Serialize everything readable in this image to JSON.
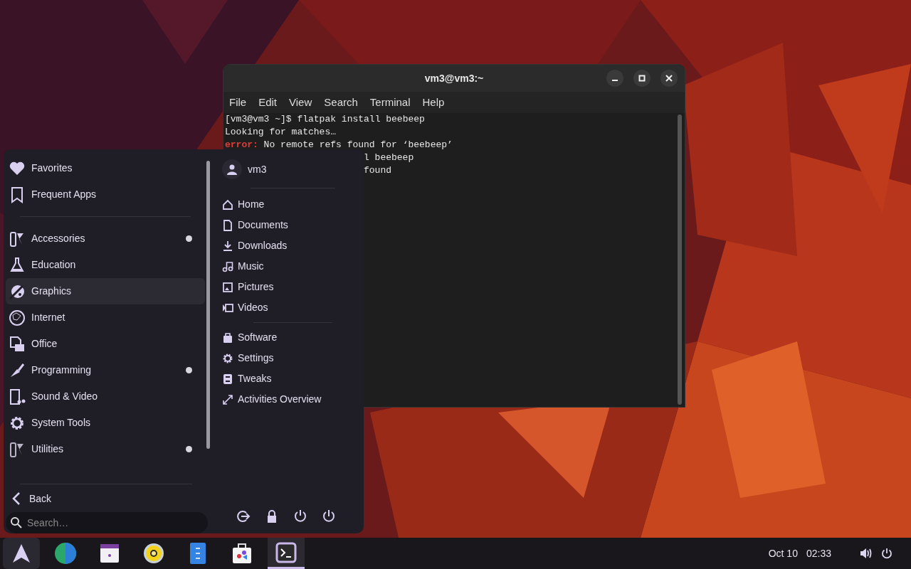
{
  "terminal": {
    "title": "vm3@vm3:~",
    "menu": [
      "File",
      "Edit",
      "View",
      "Search",
      "Terminal",
      "Help"
    ],
    "lines": [
      {
        "kind": "plain",
        "text": "[vm3@vm3 ~]$ flatpak install beebeep"
      },
      {
        "kind": "plain",
        "text": "Looking for matches…"
      },
      {
        "kind": "error",
        "label": "error:",
        "text": " No remote refs found for ‘beebeep’"
      },
      {
        "kind": "clipped",
        "text": "l beebeep"
      },
      {
        "kind": "clipped",
        "text": "found"
      }
    ]
  },
  "app_menu": {
    "categories": [
      {
        "label": "Favorites",
        "highlighted": false,
        "badge": false
      },
      {
        "label": "Frequent Apps",
        "highlighted": false,
        "badge": false
      },
      {
        "label": "Accessories",
        "highlighted": false,
        "badge": true
      },
      {
        "label": "Education",
        "highlighted": false,
        "badge": false
      },
      {
        "label": "Graphics",
        "highlighted": true,
        "badge": false
      },
      {
        "label": "Internet",
        "highlighted": false,
        "badge": false
      },
      {
        "label": "Office",
        "highlighted": false,
        "badge": false
      },
      {
        "label": "Programming",
        "highlighted": false,
        "badge": true
      },
      {
        "label": "Sound & Video",
        "highlighted": false,
        "badge": false
      },
      {
        "label": "System Tools",
        "highlighted": false,
        "badge": false
      },
      {
        "label": "Utilities",
        "highlighted": false,
        "badge": true
      }
    ],
    "back": "Back",
    "search": {
      "placeholder": "Search…"
    },
    "user": "vm3",
    "places": [
      "Home",
      "Documents",
      "Downloads",
      "Music",
      "Pictures",
      "Videos"
    ],
    "apps": [
      "Software",
      "Settings",
      "Tweaks",
      "Activities Overview"
    ]
  },
  "taskbar": {
    "apps": [
      {
        "selected": false
      },
      {
        "selected": false
      },
      {
        "selected": false
      },
      {
        "selected": false
      },
      {
        "selected": false
      },
      {
        "selected": false
      },
      {
        "selected": true
      }
    ],
    "date": "Oct 10",
    "time": "02:33"
  }
}
